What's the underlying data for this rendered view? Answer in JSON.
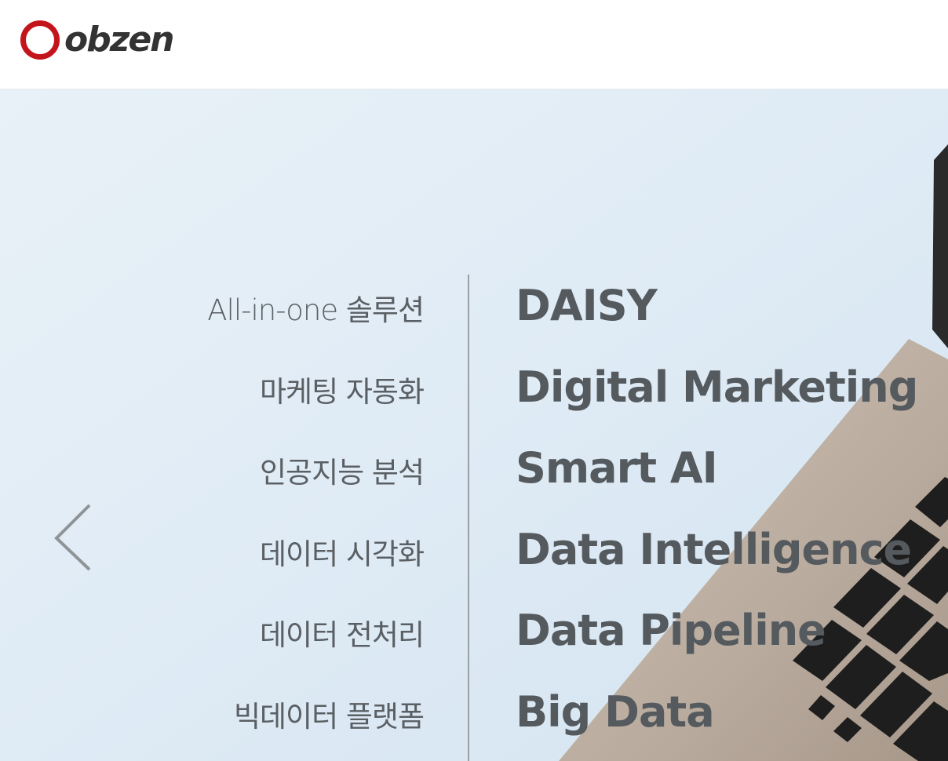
{
  "header": {
    "logo_text": "obzen",
    "brand_color": "#c4141b"
  },
  "hero": {
    "prev_icon": "chevron-left-icon",
    "categories": [
      {
        "label": "All-in-one 솔루션"
      },
      {
        "label": "마케팅 자동화"
      },
      {
        "label": "인공지능 분석"
      },
      {
        "label": "데이터 시각화"
      },
      {
        "label": "데이터 전처리"
      },
      {
        "label": "빅데이터 플랫폼"
      }
    ],
    "products": [
      {
        "label": "DAISY"
      },
      {
        "label": "Digital Marketing"
      },
      {
        "label": "Smart AI"
      },
      {
        "label": "Data Intelligence"
      },
      {
        "label": "Data Pipeline"
      },
      {
        "label": "Big Data"
      }
    ]
  }
}
